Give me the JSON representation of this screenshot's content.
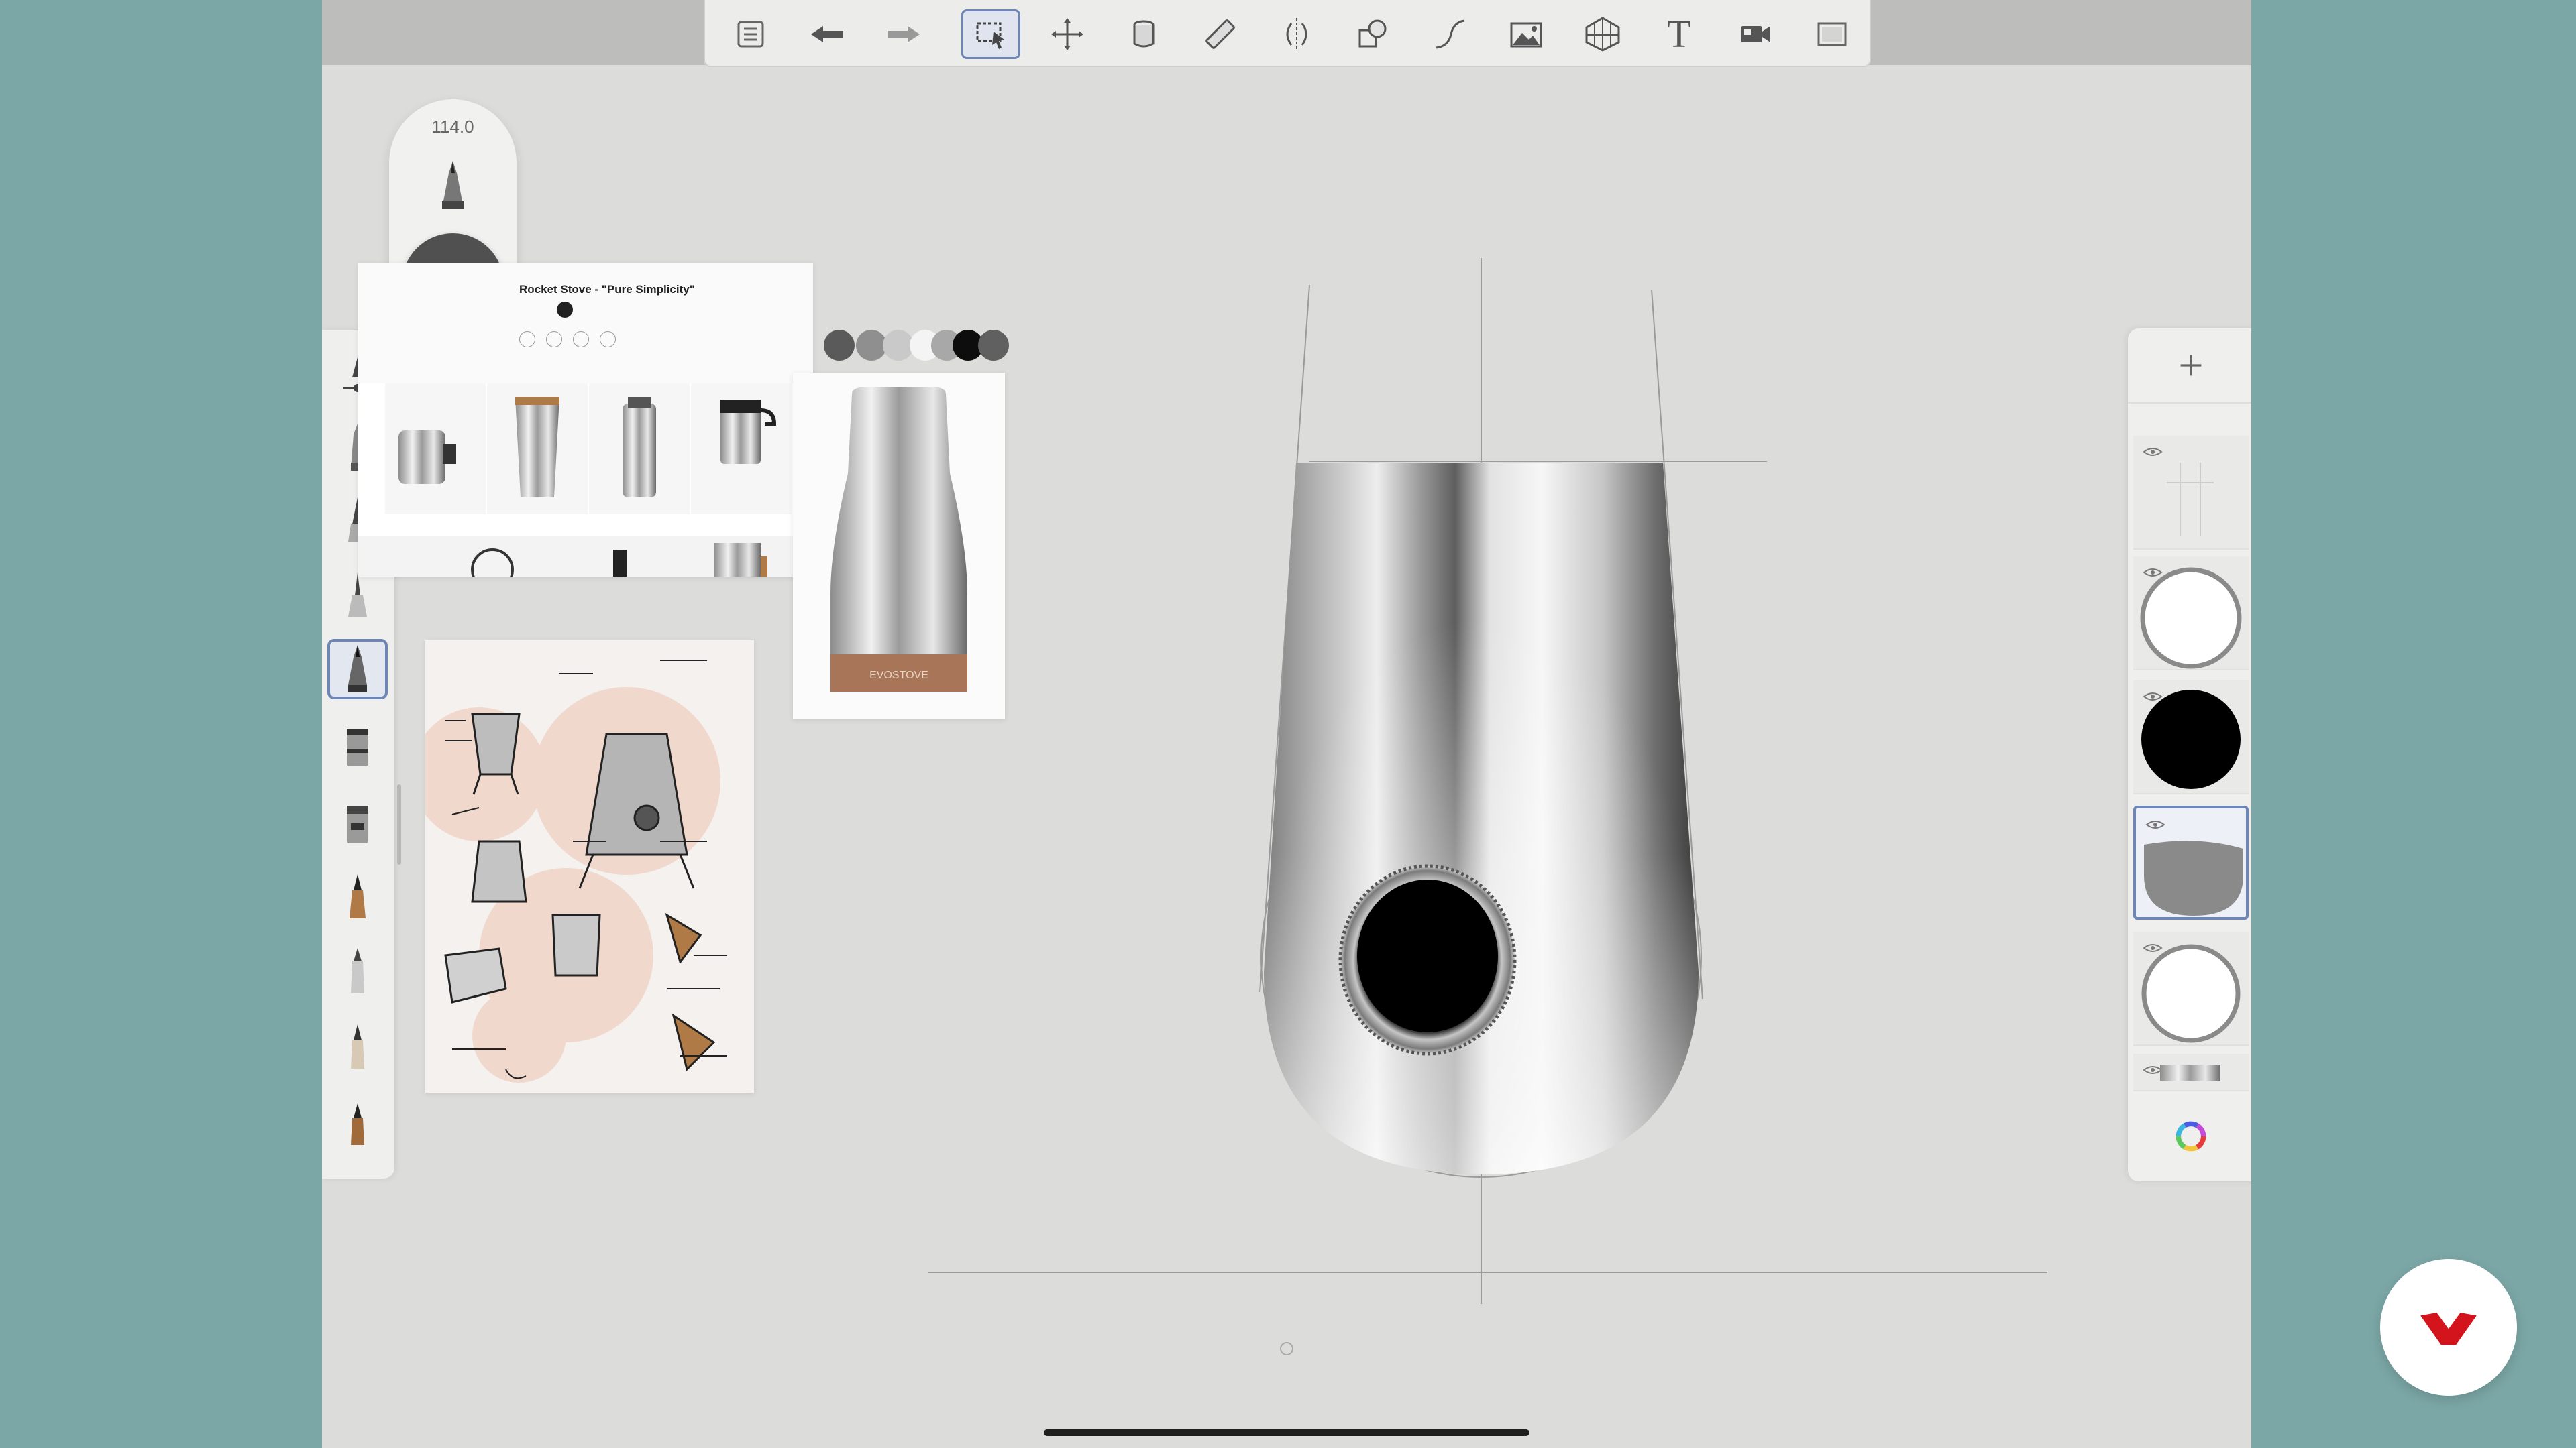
{
  "app": {
    "toolbar": {
      "items": [
        {
          "name": "gallery",
          "icon": "list-icon"
        },
        {
          "name": "undo",
          "icon": "undo-arrow-icon"
        },
        {
          "name": "redo",
          "icon": "redo-arrow-icon"
        },
        {
          "name": "selection",
          "icon": "selection-marquee-icon",
          "active": true
        },
        {
          "name": "transform",
          "icon": "move-arrows-icon"
        },
        {
          "name": "fill",
          "icon": "fill-bucket-icon"
        },
        {
          "name": "ruler",
          "icon": "ruler-icon"
        },
        {
          "name": "symmetry",
          "icon": "symmetry-icon"
        },
        {
          "name": "shapes",
          "icon": "shapes-icon"
        },
        {
          "name": "curve",
          "icon": "curve-icon"
        },
        {
          "name": "image",
          "icon": "image-icon"
        },
        {
          "name": "perspective",
          "icon": "perspective-grid-icon"
        },
        {
          "name": "text",
          "icon": "text-icon",
          "label": "T"
        },
        {
          "name": "video",
          "icon": "video-camera-icon"
        },
        {
          "name": "fullscreen",
          "icon": "fullscreen-icon"
        }
      ]
    },
    "brush_size": {
      "value": "114.0"
    },
    "current_color": "#505050",
    "reference_webpage": {
      "title": "Rocket Stove - \"Pure Simplicity\""
    },
    "product_photo_label": "EVOSTOVE",
    "palette": [
      "#5a5a5a",
      "#8f8f8f",
      "#c9c9c9",
      "#f4f4f4",
      "#a8a8a8",
      "#0d0d0d",
      "#606060"
    ],
    "brushes": [
      {
        "name": "marker",
        "active": false
      },
      {
        "name": "paint-brush",
        "active": false
      },
      {
        "name": "ballpoint-pen",
        "active": false
      },
      {
        "name": "technical-pen",
        "active": false
      },
      {
        "name": "airbrush",
        "active": true
      },
      {
        "name": "wide-marker",
        "active": false
      },
      {
        "name": "blender",
        "active": false
      },
      {
        "name": "copper-brush",
        "active": false
      },
      {
        "name": "pencil",
        "active": false
      },
      {
        "name": "fine-pencil",
        "active": false
      },
      {
        "name": "copper-pencil",
        "active": false
      }
    ],
    "layers": [
      {
        "name": "guides-layer",
        "visible": true,
        "active": false
      },
      {
        "name": "circle-outline-layer",
        "visible": true,
        "active": false
      },
      {
        "name": "black-fill-layer",
        "visible": true,
        "active": false
      },
      {
        "name": "gradient-body-layer",
        "visible": true,
        "active": true
      },
      {
        "name": "ring-layer",
        "visible": true,
        "active": false
      },
      {
        "name": "metal-strip-layer",
        "visible": true,
        "active": false
      }
    ]
  },
  "colors": {
    "accent": "#6d86b5",
    "brand_red": "#d4141c"
  }
}
